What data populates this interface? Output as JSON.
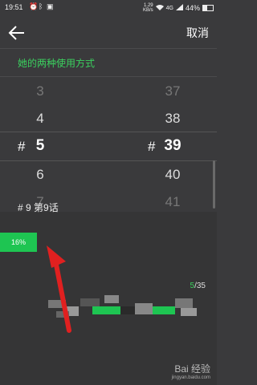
{
  "status": {
    "time": "19:51",
    "speed": "1.29\nKB/s",
    "network": "4G",
    "battery": "44%"
  },
  "topbar": {
    "cancel_label": "取消"
  },
  "subtitle": "她的两种使用方式",
  "picker": {
    "left_values": [
      "3",
      "4",
      "5",
      "6",
      "7"
    ],
    "right_values": [
      "37",
      "38",
      "39",
      "40",
      "41"
    ],
    "hash": "#"
  },
  "chapter": "# 9 第9话",
  "progress_percent": "16%",
  "count": {
    "current": "5",
    "total": "/35"
  },
  "watermark": {
    "main": "Bai 经验",
    "sub": "jingyan.baidu.com"
  },
  "colors": {
    "accent": "#3bd15f",
    "badge": "#1ec552",
    "arrow": "#e02020"
  }
}
